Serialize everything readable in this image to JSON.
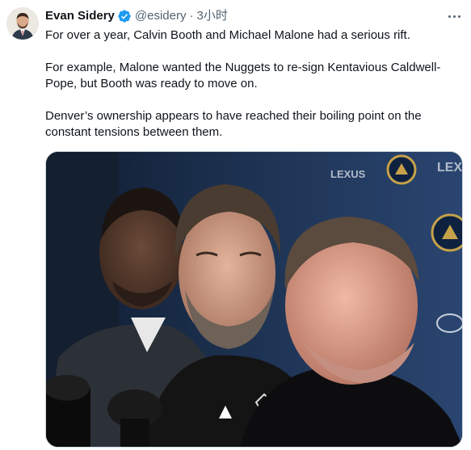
{
  "author": {
    "name": "Evan Sidery",
    "handle": "@esidery",
    "separator": "·",
    "time": "3小时",
    "verified": true,
    "verified_color": "#1d9bf0"
  },
  "tweet": {
    "paragraphs": [
      "For over a year, Calvin Booth and Michael Malone had a serious rift.",
      "For example, Malone wanted the Nuggets to re-sign Kentavious Caldwell-Pope, but Booth was ready to move on.",
      "Denver’s ownership appears to have reached their boiling point on the constant tensions between them."
    ]
  },
  "photo": {
    "backdrop_text": [
      "LEXUS",
      "LEX"
    ],
    "colors": {
      "backdrop": "#1b2a44",
      "nuggets_gold": "#c6a14a",
      "nuggets_navy": "#0e2240"
    }
  },
  "icons": {
    "verified": "verified-badge-icon",
    "more": "more-options-icon"
  }
}
